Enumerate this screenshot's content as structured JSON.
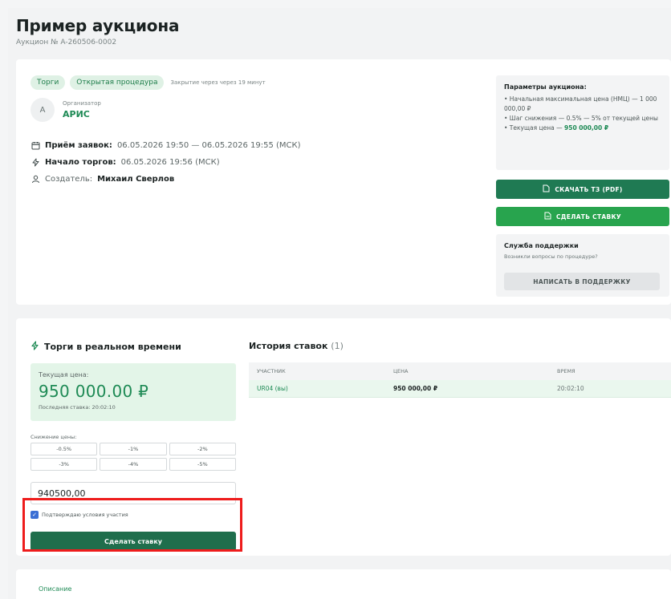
{
  "header": {
    "title": "Пример аукциона",
    "subtitle": "Аукцион № A-260506-0002"
  },
  "tags": {
    "tag1": "Торги",
    "tag2": "Открытая процедура",
    "note": "Закрытие через через 19 минут"
  },
  "organizer": {
    "avatar": "A",
    "label": "Организатор",
    "name": "АРИС"
  },
  "info": {
    "accept_label": "Приём заявок:",
    "accept_value": "06.05.2026 19:50 — 06.05.2026 19:55 (МСК)",
    "start_label": "Начало торгов:",
    "start_value": "06.05.2026 19:56 (МСК)",
    "creator_label": "Создатель:",
    "creator_value": "Михаил Сверлов"
  },
  "params": {
    "title": "Параметры аукциона:",
    "line1": "• Начальная максимальная цена (НМЦ) — 1 000 000,00 ₽",
    "line2": "• Шаг снижения — 0.5% — 5% от текущей цены",
    "line3_prefix": "• Текущая цена — ",
    "line3_value": "950 000,00 ₽"
  },
  "buttons": {
    "download": "СКАЧАТЬ ТЗ (PDF)",
    "bid": "СДЕЛАТЬ СТАВКУ"
  },
  "support": {
    "title": "Служба поддержки",
    "text": "Возникли вопросы по процедуре?",
    "button": "НАПИСАТЬ В ПОДДЕРЖКУ"
  },
  "realtime": {
    "title": "Торги в реальном времени",
    "price_label": "Текущая цена:",
    "price_value": "950 000.00 ₽",
    "last_bid": "Последняя ставка: 20:02:10",
    "decrease_label": "Снижение цены:",
    "decrease_options": [
      "-0.5%",
      "-1%",
      "-2%",
      "-3%",
      "-4%",
      "-5%"
    ],
    "bid_input_value": "940500,00",
    "confirm_label": "Подтверждаю условия участия",
    "confirm_checked": true,
    "make_bid": "Сделать ставку"
  },
  "history": {
    "title": "История ставок",
    "count": "(1)",
    "columns": [
      "УЧАСТНИК",
      "ЦЕНА",
      "ВРЕМЯ"
    ],
    "rows": [
      {
        "participant": "UR04 (вы)",
        "price": "950 000,00 ₽",
        "time": "20:02:10"
      }
    ]
  },
  "tabs": {
    "description": "Описание"
  },
  "colors": {
    "accent_green": "#1e8a55",
    "dark_green": "#1f7a53",
    "highlight_red": "#ee1c1c"
  }
}
